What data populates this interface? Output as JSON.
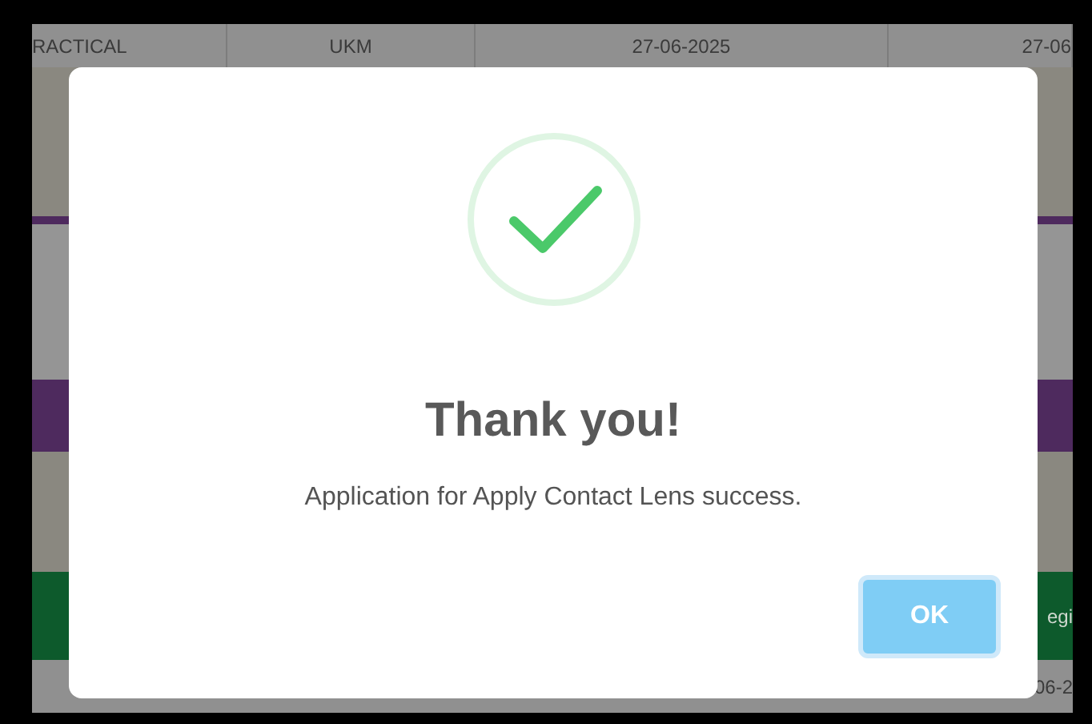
{
  "background_table": {
    "top_row": [
      "RACTICAL",
      "UKM",
      "27-06-2025",
      "27-06"
    ],
    "bands": [
      {
        "kind": "plain",
        "color": "#8a8880"
      },
      {
        "kind": "rule",
        "color": "#4e2a5e"
      },
      {
        "kind": "plain",
        "color": "#959595"
      },
      {
        "kind": "plain",
        "color": "#4e2a5e"
      },
      {
        "kind": "plain",
        "color": "#8a8880"
      },
      {
        "kind": "text",
        "color": "#0d5a2c",
        "text": "egi"
      }
    ],
    "bottom_row": [
      "06-2"
    ]
  },
  "dialog": {
    "title": "Thank you!",
    "message": "Application for Apply Contact Lens success.",
    "button": "OK"
  }
}
